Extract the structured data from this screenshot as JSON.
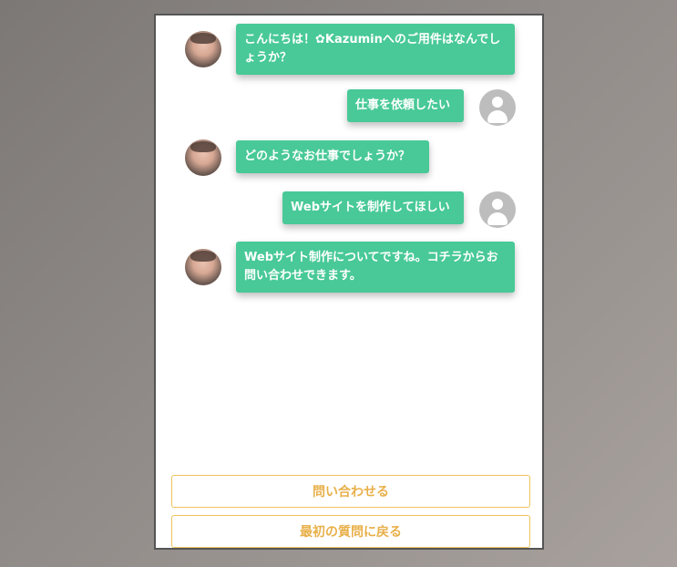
{
  "messages": [
    {
      "from": "bot",
      "text": "こんにちは！",
      "icon": "flower-icon",
      "text2": "Kazuminへのご用件はなんでしょうか？"
    },
    {
      "from": "user",
      "text": "仕事を依頼したい"
    },
    {
      "from": "bot",
      "text": "どのようなお仕事でしょうか？"
    },
    {
      "from": "user",
      "text": "Webサイトを制作してほしい"
    },
    {
      "from": "bot",
      "text": "Webサイト制作についてですね。コチラからお問い合わせできます。"
    }
  ],
  "actions": {
    "contact_label": "問い合わせる",
    "back_label": "最初の質問に戻る"
  },
  "colors": {
    "bubble": "#48c997",
    "button_text": "#e8b04a",
    "button_border": "#f1c25c",
    "user_avatar": "#bdbdbd"
  }
}
